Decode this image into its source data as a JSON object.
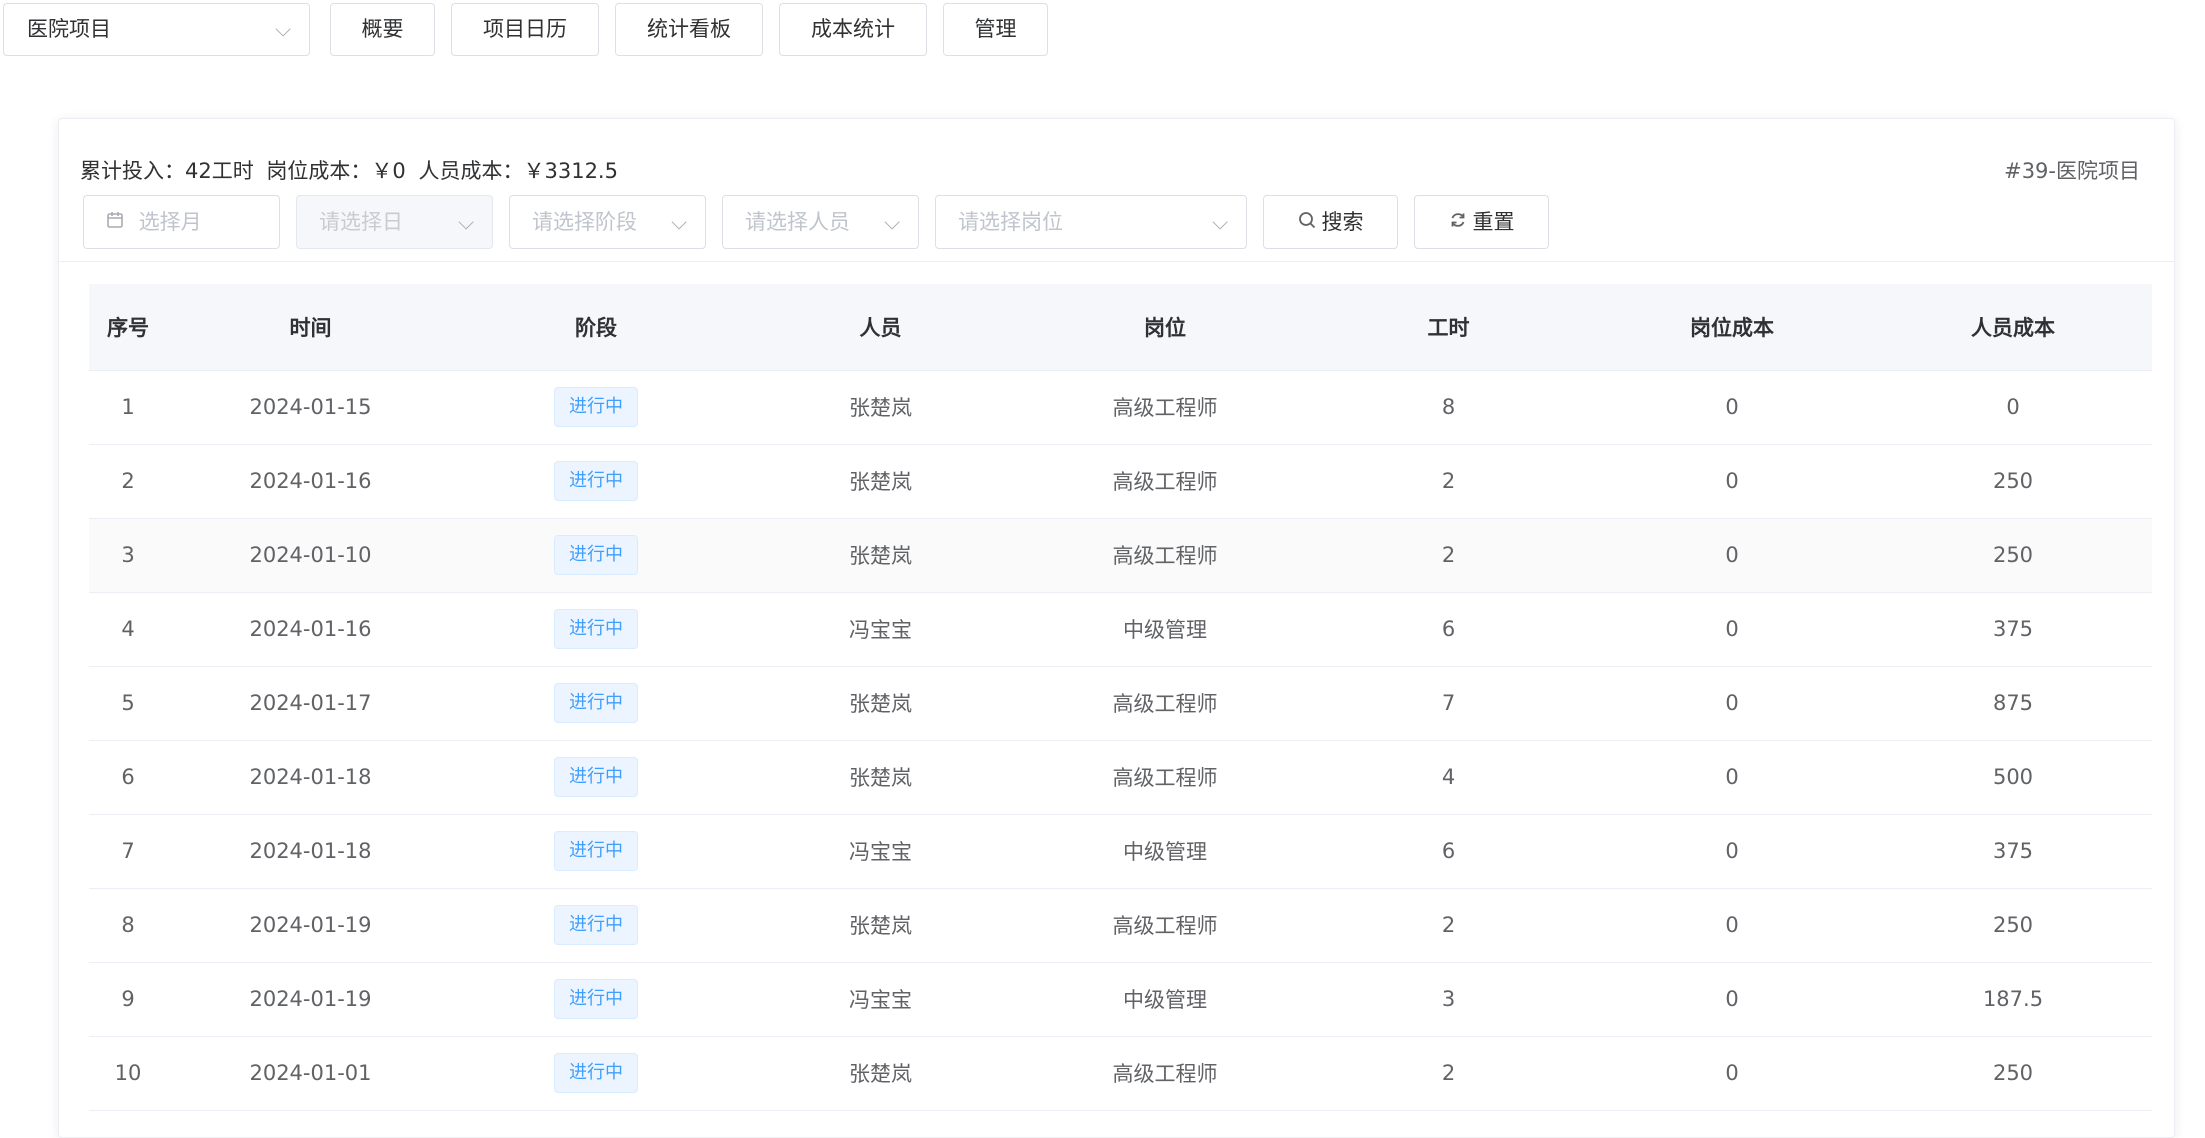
{
  "toolbar": {
    "project_select": {
      "value": "医院项目"
    },
    "buttons": [
      "概要",
      "项目日历",
      "统计看板",
      "成本统计",
      "管理"
    ]
  },
  "summary": {
    "total_input": "累计投入：42工时",
    "position_cost": "岗位成本：￥0",
    "personnel_cost": "人员成本：￥3312.5"
  },
  "project_tag": "#39-医院项目",
  "filters": {
    "month_placeholder": "选择月",
    "day_placeholder": "请选择日",
    "stage_placeholder": "请选择阶段",
    "person_placeholder": "请选择人员",
    "position_placeholder": "请选择岗位"
  },
  "actions": {
    "search_label": "搜索",
    "reset_label": "重置"
  },
  "table": {
    "columns": [
      "序号",
      "时间",
      "阶段",
      "人员",
      "岗位",
      "工时",
      "岗位成本",
      "人员成本"
    ],
    "rows": [
      [
        "1",
        "2024-01-15",
        "进行中",
        "张楚岚",
        "高级工程师",
        "8",
        "0",
        "0"
      ],
      [
        "2",
        "2024-01-16",
        "进行中",
        "张楚岚",
        "高级工程师",
        "2",
        "0",
        "250"
      ],
      [
        "3",
        "2024-01-10",
        "进行中",
        "张楚岚",
        "高级工程师",
        "2",
        "0",
        "250"
      ],
      [
        "4",
        "2024-01-16",
        "进行中",
        "冯宝宝",
        "中级管理",
        "6",
        "0",
        "375"
      ],
      [
        "5",
        "2024-01-17",
        "进行中",
        "张楚岚",
        "高级工程师",
        "7",
        "0",
        "875"
      ],
      [
        "6",
        "2024-01-18",
        "进行中",
        "张楚岚",
        "高级工程师",
        "4",
        "0",
        "500"
      ],
      [
        "7",
        "2024-01-18",
        "进行中",
        "冯宝宝",
        "中级管理",
        "6",
        "0",
        "375"
      ],
      [
        "8",
        "2024-01-19",
        "进行中",
        "张楚岚",
        "高级工程师",
        "2",
        "0",
        "250"
      ],
      [
        "9",
        "2024-01-19",
        "进行中",
        "冯宝宝",
        "中级管理",
        "3",
        "0",
        "187.5"
      ],
      [
        "10",
        "2024-01-01",
        "进行中",
        "张楚岚",
        "高级工程师",
        "2",
        "0",
        "250"
      ]
    ]
  },
  "colors": {
    "accent": "#409eff",
    "tag_bg": "#ecf5ff",
    "header_bg": "#f5f7fa"
  }
}
